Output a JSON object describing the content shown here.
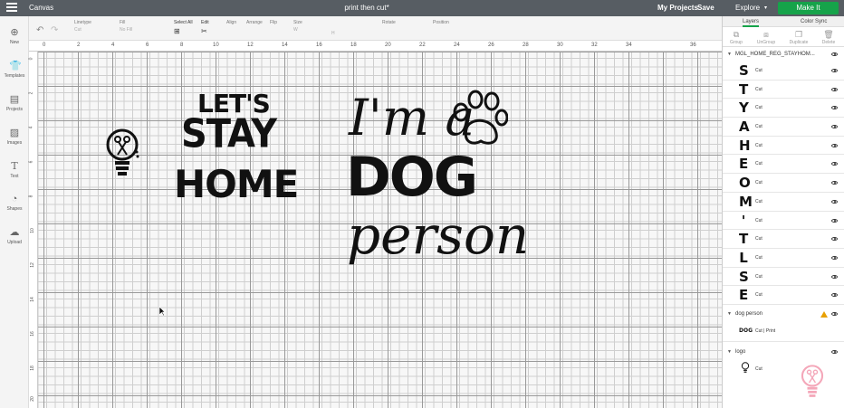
{
  "topbar": {
    "app_title": "Canvas",
    "project_title": "print then cut*",
    "my_projects": "My Projects",
    "save": "Save",
    "explore": "Explore",
    "make_it": "Make It"
  },
  "toolbar": {
    "linetype_label": "Linetype",
    "linetype_value": "Cut",
    "fill_label": "Fill",
    "fill_value": "No Fill",
    "select_all": "Select All",
    "edit": "Edit",
    "align": "Align",
    "arrange": "Arrange",
    "flip": "Flip",
    "size": "Size",
    "rotate": "Rotate",
    "position": "Position",
    "size_w": "W",
    "size_h": "H"
  },
  "leftbar": {
    "items": [
      {
        "label": "New",
        "icon": "plus-icon"
      },
      {
        "label": "Templates",
        "icon": "shirt-icon"
      },
      {
        "label": "Projects",
        "icon": "projects-icon"
      },
      {
        "label": "Images",
        "icon": "image-icon"
      },
      {
        "label": "Text",
        "icon": "text-icon"
      },
      {
        "label": "Shapes",
        "icon": "shapes-icon"
      },
      {
        "label": "Upload",
        "icon": "upload-icon"
      }
    ]
  },
  "ruler": {
    "top": [
      "0",
      "2",
      "4",
      "6",
      "8",
      "10",
      "12",
      "14",
      "16",
      "18",
      "20",
      "22",
      "24",
      "26",
      "28",
      "30",
      "32",
      "34",
      "36"
    ],
    "left": [
      "0",
      "2",
      "4",
      "6",
      "8",
      "10",
      "12",
      "14",
      "16",
      "18",
      "20"
    ]
  },
  "canvas": {
    "lets": "LET'S",
    "stay": "STAY",
    "home": "HOME",
    "ima": "I'm a",
    "dog": "DOG",
    "person": "person"
  },
  "panel": {
    "tab_layers": "Layers",
    "tab_colorsync": "Color Sync",
    "tools": [
      "Group",
      "UnGroup",
      "Duplicate",
      "Delete"
    ],
    "group1_name": "MGL_HOME_REG_STAYHOM...",
    "group1_layers": [
      {
        "glyph": "S",
        "op": "Cut"
      },
      {
        "glyph": "T",
        "op": "Cut"
      },
      {
        "glyph": "Y",
        "op": "Cut"
      },
      {
        "glyph": "A",
        "op": "Cut"
      },
      {
        "glyph": "H",
        "op": "Cut"
      },
      {
        "glyph": "E",
        "op": "Cut"
      },
      {
        "glyph": "O",
        "op": "Cut"
      },
      {
        "glyph": "M",
        "op": "Cut"
      },
      {
        "glyph": "'",
        "op": "Cut"
      },
      {
        "glyph": "T",
        "op": "Cut"
      },
      {
        "glyph": "L",
        "op": "Cut"
      },
      {
        "glyph": "S",
        "op": "Cut"
      },
      {
        "glyph": "E",
        "op": "Cut"
      }
    ],
    "group2_name": "dog person",
    "group2_op": "Cut | Print",
    "group2_thumb": "DOG",
    "group3_name": "logo",
    "group3_op": "Cut"
  },
  "colors": {
    "topbar": "#575d63",
    "make_it": "#16a34a",
    "warning": "#e8a000",
    "watermark": "#f4a7b9"
  }
}
